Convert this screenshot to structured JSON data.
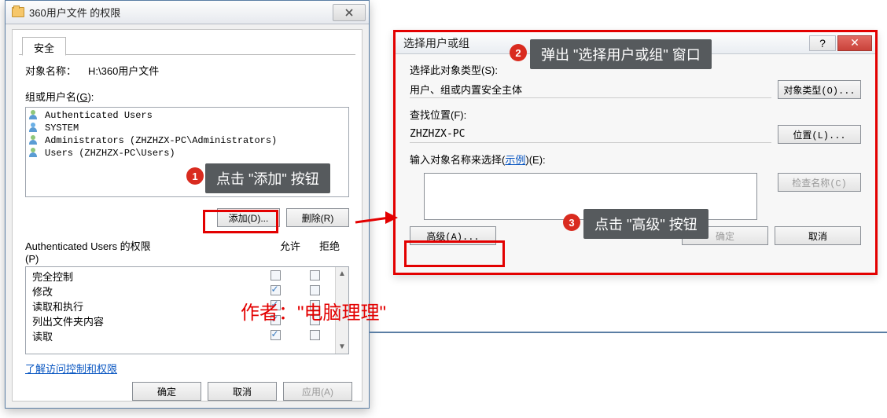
{
  "left": {
    "title": "360用户文件 的权限",
    "tab": "安全",
    "object_label": "对象名称：",
    "object_value": "H:\\360用户文件",
    "group_label_prefix": "组或用户名(",
    "group_label_accel": "G",
    "group_label_suffix": "):",
    "users": {
      "u0": "Authenticated Users",
      "u1": "SYSTEM",
      "u2": "Administrators (ZHZHZX-PC\\Administrators)",
      "u3": "Users (ZHZHZX-PC\\Users)"
    },
    "add_btn": "添加(D)...",
    "remove_btn": "删除(R)",
    "perm_for_prefix": "Authenticated Users 的权限",
    "perm_for_accel": "(P)",
    "allow": "允许",
    "deny": "拒绝",
    "perms": {
      "p0": "完全控制",
      "p1": "修改",
      "p2": "读取和执行",
      "p3": "列出文件夹内容",
      "p4": "读取"
    },
    "link": "了解访问控制和权限",
    "ok": "确定",
    "cancel": "取消",
    "apply": "应用(A)"
  },
  "right": {
    "title": "选择用户或组",
    "obj_type_label": "选择此对象类型(S):",
    "obj_type_value": "用户、组或内置安全主体",
    "obj_type_btn": "对象类型(O)...",
    "loc_label": "查找位置(F):",
    "loc_value": "ZHZHZX-PC",
    "loc_btn": "位置(L)...",
    "names_label_pre": "输入对象名称来选择(",
    "names_label_link": "示例",
    "names_label_post": ")(E):",
    "check_btn": "检查名称(C)",
    "adv_btn": "高级(A)...",
    "ok": "确定",
    "cancel": "取消"
  },
  "annotations": {
    "b1": "1",
    "t1": "点击 \"添加\" 按钮",
    "b2": "2",
    "t2": "弹出 \"选择用户或组\" 窗口",
    "b3": "3",
    "t3": "点击 \"高级\" 按钮",
    "author": "作者：\"电脑理理\""
  }
}
